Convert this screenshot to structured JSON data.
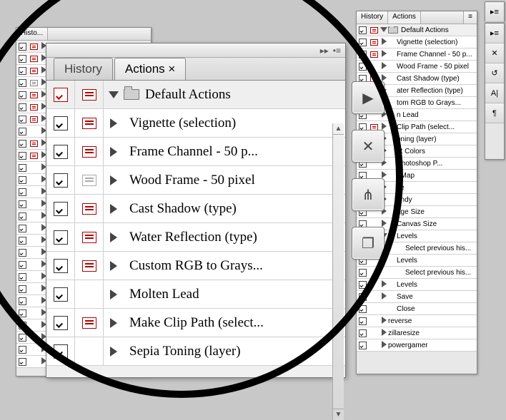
{
  "tabs": {
    "history": "History",
    "actions": "Actions",
    "actions_close": "Actions ×"
  },
  "folder_label": "Default Actions",
  "big_actions": [
    {
      "check": "red-on",
      "dlg": "red",
      "expand": "down",
      "folder": true,
      "label_key": "folder_label"
    },
    {
      "check": "on",
      "dlg": "red",
      "expand": "right",
      "label": "Vignette (selection)"
    },
    {
      "check": "on",
      "dlg": "red",
      "expand": "right",
      "label": "Frame Channel - 50 p..."
    },
    {
      "check": "on",
      "dlg": "gray",
      "expand": "right",
      "label": "Wood Frame - 50 pixel"
    },
    {
      "check": "on",
      "dlg": "red",
      "expand": "right",
      "label": "Cast Shadow (type)"
    },
    {
      "check": "on",
      "dlg": "red",
      "expand": "right",
      "label": "Water Reflection (type)"
    },
    {
      "check": "on",
      "dlg": "red",
      "expand": "right",
      "label": "Custom RGB to Grays..."
    },
    {
      "check": "on",
      "dlg": "none",
      "expand": "right",
      "label": "Molten Lead"
    },
    {
      "check": "on",
      "dlg": "red",
      "expand": "right",
      "label": "Make Clip Path (select..."
    },
    {
      "check": "on",
      "dlg": "none",
      "expand": "right",
      "label": "Sepia Toning (layer)"
    }
  ],
  "bg_tabs_left": "Histo...",
  "bg_extras": [
    {
      "label": "reverse"
    },
    {
      "label": "zillaresize"
    }
  ],
  "right_actions": [
    {
      "check": true,
      "dlg": "red",
      "expand": "down",
      "folder": true,
      "label": "Default Actions",
      "level": 0
    },
    {
      "check": true,
      "dlg": "red",
      "expand": "right",
      "label": "Vignette (selection)",
      "level": 1
    },
    {
      "check": true,
      "dlg": "red",
      "expand": "right",
      "label": "Frame Channel - 50 p...",
      "level": 1
    },
    {
      "check": true,
      "dlg": "none",
      "expand": "right",
      "label": "Wood Frame - 50 pixel",
      "level": 1
    },
    {
      "check": true,
      "dlg": "red",
      "expand": "right",
      "label": "Cast Shadow (type)",
      "level": 1
    },
    {
      "check": true,
      "dlg": "red",
      "expand": "right",
      "label": "ater Reflection (type)",
      "level": 1
    },
    {
      "check": true,
      "dlg": "red",
      "expand": "right",
      "label": "tom RGB to Grays...",
      "level": 1
    },
    {
      "check": true,
      "dlg": "none",
      "expand": "right",
      "label": "n Lead",
      "level": 1
    },
    {
      "check": true,
      "dlg": "red",
      "expand": "right",
      "label": "Clip Path (select...",
      "level": 1
    },
    {
      "check": true,
      "dlg": "none",
      "expand": "right",
      "label": "oning (layer)",
      "level": 1
    },
    {
      "check": true,
      "dlg": "none",
      "expand": "right",
      "label": "nt Colors",
      "level": 1
    },
    {
      "check": true,
      "dlg": "none",
      "expand": "right",
      "label": " Photoshop P...",
      "level": 1
    },
    {
      "check": true,
      "dlg": "none",
      "expand": "right",
      "label": "t Map",
      "level": 1
    },
    {
      "check": true,
      "dlg": "none",
      "expand": "right",
      "label": "ke",
      "level": 1
    },
    {
      "check": true,
      "dlg": "none",
      "expand": "right",
      "label": "andy",
      "level": 1
    },
    {
      "check": true,
      "dlg": "none",
      "expand": "right",
      "label": "age Size",
      "level": 1
    },
    {
      "check": true,
      "dlg": "none",
      "expand": "right",
      "label": "Canvas Size",
      "level": 1
    },
    {
      "check": true,
      "dlg": "none",
      "expand": "down",
      "label": "Levels",
      "level": 1
    },
    {
      "check": true,
      "dlg": "none",
      "expand": "",
      "label": "Select previous his...",
      "level": 2
    },
    {
      "check": true,
      "dlg": "none",
      "expand": "down",
      "label": "Levels",
      "level": 1
    },
    {
      "check": true,
      "dlg": "none",
      "expand": "",
      "label": "Select previous his...",
      "level": 2
    },
    {
      "check": true,
      "dlg": "none",
      "expand": "right",
      "label": "Levels",
      "level": 1
    },
    {
      "check": true,
      "dlg": "none",
      "expand": "right",
      "label": "Save",
      "level": 1
    },
    {
      "check": true,
      "dlg": "none",
      "expand": "",
      "label": "Close",
      "level": 1
    },
    {
      "check": true,
      "dlg": "none",
      "expand": "right",
      "label": "reverse",
      "level": 0
    },
    {
      "check": true,
      "dlg": "none",
      "expand": "right",
      "label": "zillaresize",
      "level": 0
    },
    {
      "check": true,
      "dlg": "none",
      "expand": "right",
      "label": "powergamer",
      "level": 0
    }
  ],
  "right_buttons": {
    "play": "▶",
    "menu": "≡"
  },
  "big_buttons": [
    {
      "name": "play-button",
      "glyph": "▶"
    },
    {
      "name": "tools-button",
      "glyph": "✕"
    },
    {
      "name": "brushes-button",
      "glyph": "⋔"
    },
    {
      "name": "layers-button",
      "glyph": "❐"
    }
  ],
  "far_tools": [
    {
      "name": "menu-icon",
      "g": "▸≡"
    },
    {
      "name": "crossed-tools-icon",
      "g": "✕"
    },
    {
      "name": "history-icon",
      "g": "↺"
    },
    {
      "name": "char-icon",
      "g": "A|"
    },
    {
      "name": "para-icon",
      "g": "¶"
    }
  ]
}
